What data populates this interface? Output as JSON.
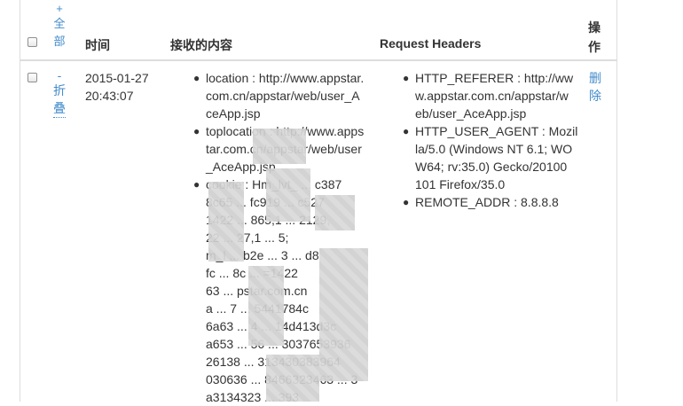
{
  "header": {
    "select_all_label": "全部",
    "select_all_prefix": "+",
    "time_col": "时间",
    "content_col": "接收的内容",
    "headers_col": "Request Headers",
    "action_col": "操作"
  },
  "rows": [
    {
      "toggle_prefix": "-",
      "toggle_label": "折叠",
      "time_date": "2015-01-27",
      "time_clock": "20:43:07",
      "content_items": [
        "location : http://www.appstar.com.cn/appstar/web/user_AceApp.jsp",
        "toplocation : http://www.appstar.com.cn/appstar/web/user_AceApp.jsp",
        "cookie : Hm_lvt_ ... c387 ... 8c65 ... fc919 ... c527 ... 1422 ... 865,1 ... 2129, ... 22 ... 27,1 ... 5; ... m_l ... b2e ... 3 ... d8 ... fc ... 8c ... =1422 ... 63 ... pstar.com.cn ... a ... 7 ... 5441784c ... 6a63 ... 4 ... 14d413d3c ... a653 ... 56 ... 3037653936 ... 26138 ... 313430383964 ... 030636 ... 8466323463 ... 3 ... a3134323 ... 393"
      ],
      "content_lines": [
        [
          "location : http://www.appstar.",
          "com.cn/appstar/web/user_A",
          "ceApp.jsp"
        ],
        [
          "toplocation : http://www.apps",
          "tar.com.cn/appstar/web/user",
          "_AceApp.jsp"
        ],
        [
          "cookie : Hm_lvt_ ... c387",
          "8c65 ... fc919 ... c527",
          "1422 ... 865,1 ... 2129,",
          "22 ... 27,1 ... 5;",
          "m_l ... b2e ... 3 ... d8",
          "fc ... 8c ... =1422",
          "63 ... pstar.com.cn",
          "a ... 7 ... 5441784c",
          "6a63 ... 4 ... 14d413d3c",
          "a653 ... 56 ... 3037653936",
          "26138 ... 313430383964",
          "030636 ... 8466323463 ... 3",
          "a3134323 ... 393"
        ]
      ],
      "header_lines": [
        [
          "HTTP_REFERER : http://ww",
          "w.appstar.com.cn/appstar/w",
          "eb/user_AceApp.jsp"
        ],
        [
          "HTTP_USER_AGENT : Mozil",
          "la/5.0 (Windows NT 6.1; WO",
          "W64; rv:35.0) Gecko/20100",
          "101 Firefox/35.0"
        ],
        [
          "REMOTE_ADDR : 8.8.8.8"
        ]
      ],
      "action_label": "删除"
    }
  ],
  "icons": {
    "bullet": "disc-bullet-icon"
  }
}
